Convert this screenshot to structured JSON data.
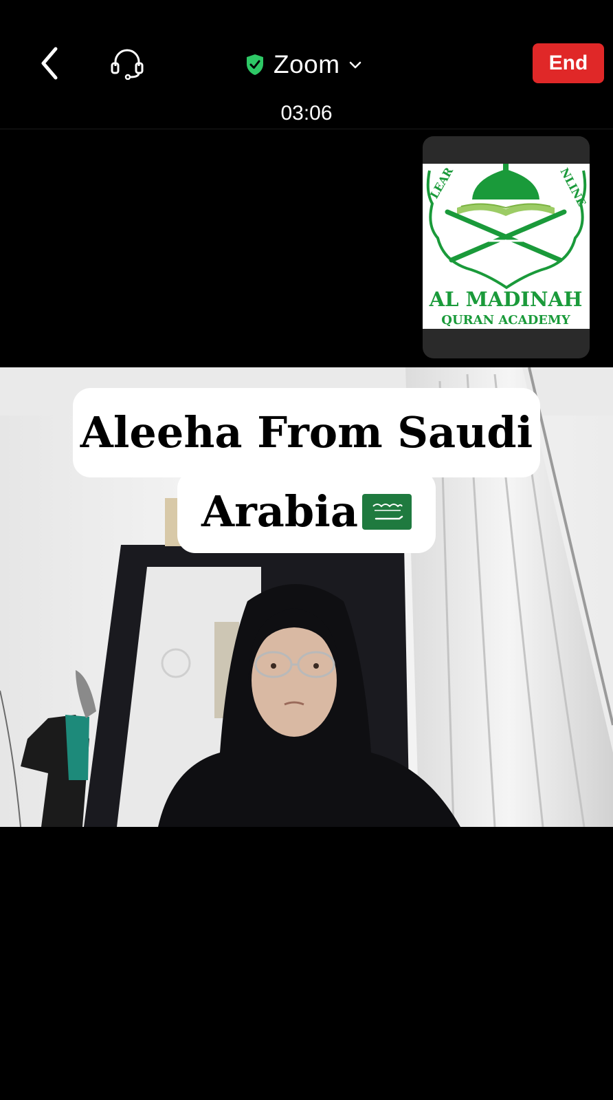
{
  "header": {
    "back_icon": "chevron-left-icon",
    "headset_icon": "headset-icon",
    "shield_icon": "shield-check-icon",
    "app_title": "Zoom",
    "dropdown_icon": "chevron-down-icon",
    "end_label": "End",
    "call_timer": "03:06",
    "colors": {
      "end_button": "#e02828",
      "shield": "#2ec866"
    }
  },
  "self_view": {
    "logo": {
      "arc_text": "LEARN QURAN ONLINE",
      "title": "AL MADINAH",
      "subtitle": "QURAN ACADEMY",
      "colors": {
        "green": "#1a9a3a",
        "light_green": "#9ccc65"
      }
    }
  },
  "video": {
    "caption_line1": "Aleeha From Saudi",
    "caption_line2": "Arabia",
    "flag_icon": "saudi-arabia-flag-icon",
    "colors": {
      "flag": "#1f7a3f"
    }
  }
}
